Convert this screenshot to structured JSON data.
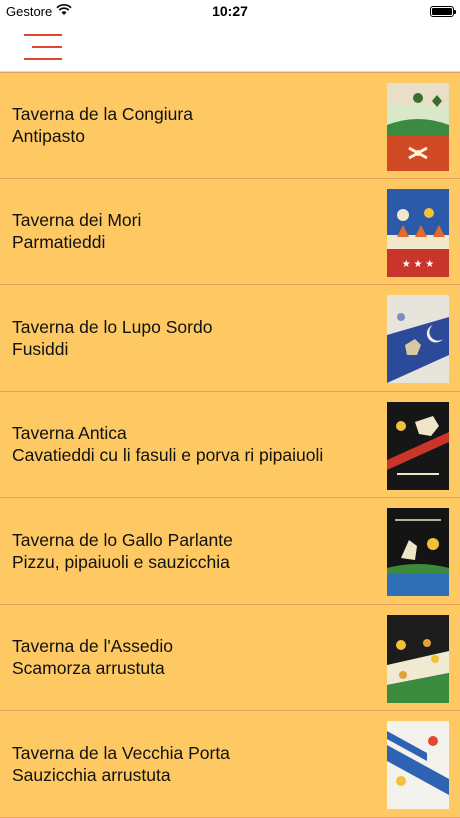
{
  "status": {
    "carrier": "Gestore",
    "time": "10:27"
  },
  "nav": {
    "menu_icon": "hamburger-menu-icon"
  },
  "colors": {
    "row_bg": "#fec963",
    "row_border": "#e9a05b",
    "accent": "#e0452e"
  },
  "taverns": [
    {
      "name": "Taverna de la Congiura",
      "dish": "Antipasto",
      "banner_icon": "congiura-banner-icon"
    },
    {
      "name": "Taverna dei Mori",
      "dish": "Parmatieddi",
      "banner_icon": "mori-banner-icon"
    },
    {
      "name": "Taverna de lo Lupo Sordo",
      "dish": "Fusiddi",
      "banner_icon": "lupo-sordo-banner-icon"
    },
    {
      "name": "Taverna Antica",
      "dish": "Cavatieddi cu li fasuli e porva ri pipaiuoli",
      "banner_icon": "antica-banner-icon"
    },
    {
      "name": "Taverna de lo Gallo Parlante",
      "dish": "Pizzu, pipaiuoli e sauzicchia",
      "banner_icon": "gallo-parlante-banner-icon"
    },
    {
      "name": "Taverna de l'Assedio",
      "dish": "Scamorza arrustuta",
      "banner_icon": "assedio-banner-icon"
    },
    {
      "name": "Taverna de la Vecchia Porta",
      "dish": "Sauzicchia arrustuta",
      "banner_icon": "vecchia-porta-banner-icon"
    }
  ]
}
